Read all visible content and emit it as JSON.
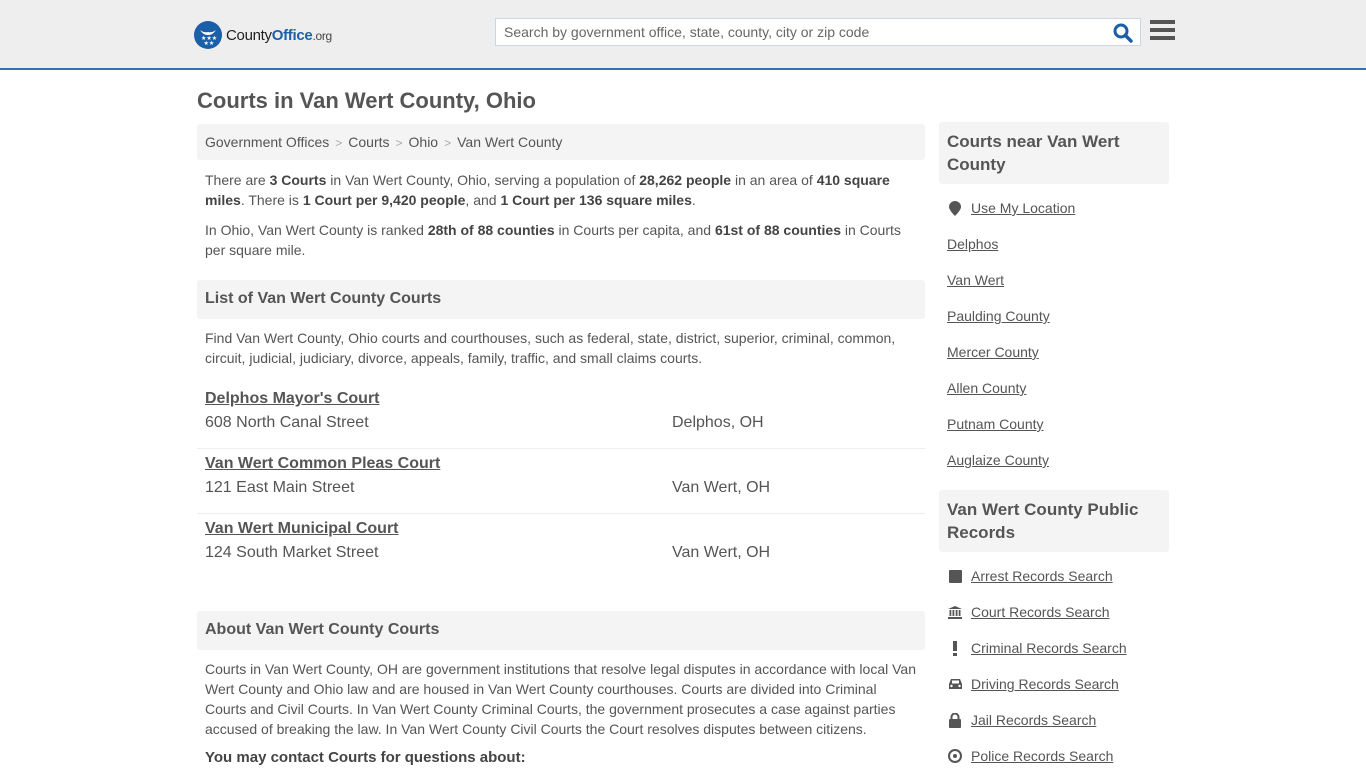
{
  "header": {
    "logo": {
      "prefix": "County",
      "brand": "Office",
      "tld": ".org"
    },
    "search": {
      "placeholder": "Search by government office, state, county, city or zip code",
      "value": ""
    },
    "icons": {
      "search": "search-icon",
      "menu": "hamburger-menu-icon"
    }
  },
  "page": {
    "title": "Courts in Van Wert County, Ohio",
    "breadcrumb": [
      "Government Offices",
      "Courts",
      "Ohio",
      "Van Wert County"
    ],
    "summary": {
      "t1": "There are ",
      "b1": "3 Courts",
      "t2": " in Van Wert County, Ohio, serving a population of ",
      "b2": "28,262 people",
      "t3": " in an area of ",
      "b3": "410 square miles",
      "t4": ". There is ",
      "b4": "1 Court per 9,420 people",
      "t5": ", and ",
      "b5": "1 Court per 136 square miles",
      "t6": "."
    },
    "ranking": {
      "t1": "In Ohio, Van Wert County is ranked ",
      "b1": "28th of 88 counties",
      "t2": " in Courts per capita, and ",
      "b2": "61st of 88 counties",
      "t3": " in Courts per square mile."
    },
    "list_section": {
      "heading": "List of Van Wert County Courts",
      "description": "Find Van Wert County, Ohio courts and courthouses, such as federal, state, district, superior, criminal, common, circuit, judicial, judiciary, divorce, appeals, family, traffic, and small claims courts.",
      "courts": [
        {
          "name": "Delphos Mayor's Court",
          "address": "608 North Canal Street",
          "city": "Delphos, OH"
        },
        {
          "name": "Van Wert Common Pleas Court",
          "address": "121 East Main Street",
          "city": "Van Wert, OH"
        },
        {
          "name": "Van Wert Municipal Court",
          "address": "124 South Market Street",
          "city": "Van Wert, OH"
        }
      ]
    },
    "about_section": {
      "heading": "About Van Wert County Courts",
      "text": "Courts in Van Wert County, OH are government institutions that resolve legal disputes in accordance with local Van Wert County and Ohio law and are housed in Van Wert County courthouses. Courts are divided into Criminal Courts and Civil Courts. In Van Wert County Criminal Courts, the government prosecutes a case against parties accused of breaking the law. In Van Wert County Civil Courts the Court resolves disputes between citizens.",
      "contact_heading": "You may contact Courts for questions about:"
    }
  },
  "sidebar": {
    "nearby": {
      "heading": "Courts near Van Wert County",
      "use_location": "Use My Location",
      "links": [
        "Delphos",
        "Van Wert",
        "Paulding County",
        "Mercer County",
        "Allen County",
        "Putnam County",
        "Auglaize County"
      ]
    },
    "records": {
      "heading": "Van Wert County Public Records",
      "links": [
        {
          "label": "Arrest Records Search",
          "icon": "square-icon"
        },
        {
          "label": "Court Records Search",
          "icon": "courthouse-icon"
        },
        {
          "label": "Criminal Records Search",
          "icon": "exclamation-icon"
        },
        {
          "label": "Driving Records Search",
          "icon": "car-icon"
        },
        {
          "label": "Jail Records Search",
          "icon": "lock-icon"
        },
        {
          "label": "Police Records Search",
          "icon": "police-badge-icon"
        }
      ]
    }
  },
  "colors": {
    "brand_blue": "#1b5fa8",
    "accent_border": "#2e74b5",
    "text": "#555555",
    "panel_bg": "#f4f4f4",
    "topbar_bg": "#eeeeee"
  }
}
